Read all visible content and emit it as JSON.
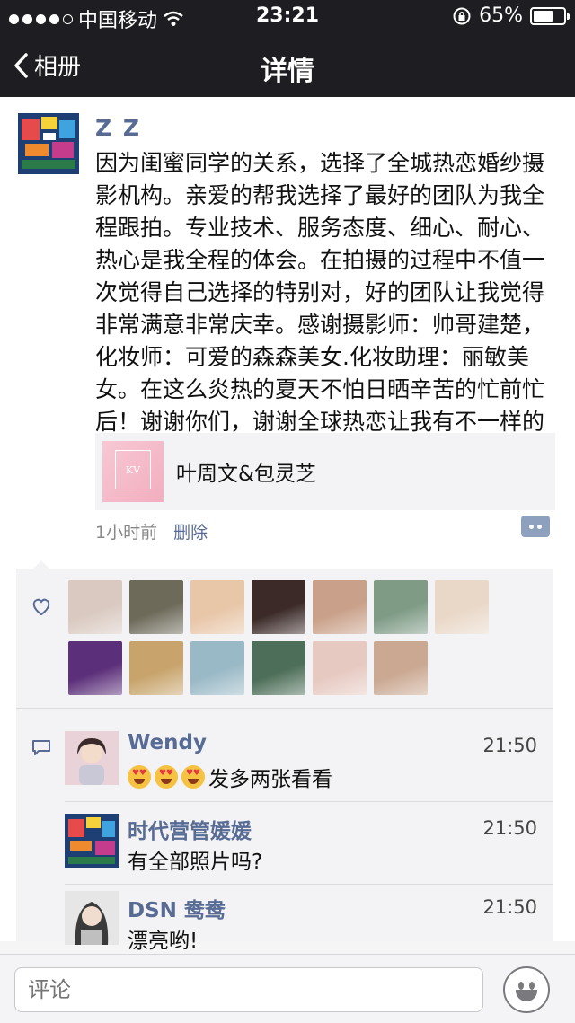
{
  "status_bar": {
    "carrier": "中国移动",
    "time": "23:21",
    "battery": "65%",
    "battery_level": 0.65,
    "signal_bars": 4
  },
  "nav": {
    "back_label": "相册",
    "title": "详情"
  },
  "post": {
    "author": "Z Z",
    "text": "因为闺蜜同学的关系，选择了全城热恋婚纱摄影机构。亲爱的帮我选择了最好的团队为我全程跟拍。专业技术、服务态度、细心、耐心、热心是我全程的体会。在拍摄的过程中不值一次觉得自己选择的特别对，好的团队让我觉得非常满意非常庆幸。感谢摄影师：帅哥建楚，化妆师：可爱的森森美女.化妆助理：丽敏美女。在这么炎热的夏天不怕日晒辛苦的忙前忙后！谢谢你们，谢谢全球热恋让我有不一样的自己！",
    "link_card_title": "叶周文&包灵芝",
    "time_ago": "1小时前",
    "delete_label": "删除",
    "like_avatar_colors": [
      "#d9c9c0",
      "#6d6a5a",
      "#e8c6a8",
      "#3b2a28",
      "#c9a089",
      "#7f9b86",
      "#e9d8c8",
      "#5c2f7a",
      "#c8a46c",
      "#9ab9c6",
      "#4d6e58",
      "#e6c9c1",
      "#caa892"
    ]
  },
  "comments": [
    {
      "name": "Wendy",
      "time": "21:50",
      "emoji_count": 3,
      "text": "发多两张看看",
      "avatar_color": "#d4b5b5"
    },
    {
      "name": "时代营管媛媛",
      "time": "21:50",
      "emoji_count": 0,
      "text": "有全部照片吗?",
      "avatar_color": "#2d5a8a"
    },
    {
      "name": "DSN 鸯鸯",
      "time": "21:50",
      "emoji_count": 0,
      "text": "漂亮哟!",
      "avatar_color": "#cfcfcf"
    }
  ],
  "input_bar": {
    "placeholder": "评论"
  }
}
